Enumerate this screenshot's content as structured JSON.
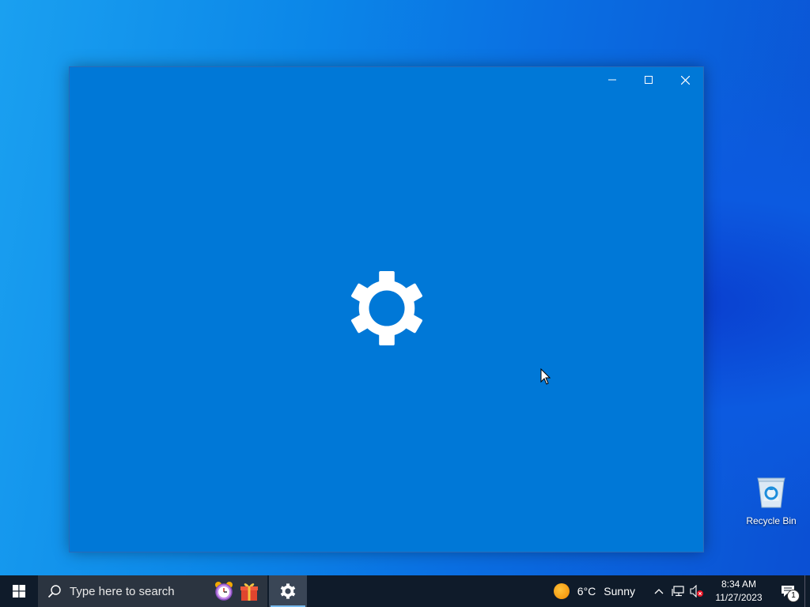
{
  "desktop": {
    "icons": [
      {
        "label": "Recycle Bin",
        "icon": "recycle-bin-icon"
      }
    ]
  },
  "window": {
    "app": "Settings",
    "splash_icon": "gear-icon",
    "background": "#0078d7",
    "controls": [
      "minimize",
      "maximize",
      "close"
    ]
  },
  "taskbar": {
    "search_placeholder": "Type here to search",
    "pinned": [
      {
        "name": "Alarms & Clock",
        "icon": "alarm-clock-icon"
      },
      {
        "name": "Gift",
        "icon": "gift-icon"
      }
    ],
    "running_app_icon": "settings-gear-icon",
    "weather": {
      "temperature": "6°C",
      "condition": "Sunny"
    },
    "clock": {
      "time": "8:34 AM",
      "date": "11/27/2023"
    },
    "notification_count": "1"
  }
}
